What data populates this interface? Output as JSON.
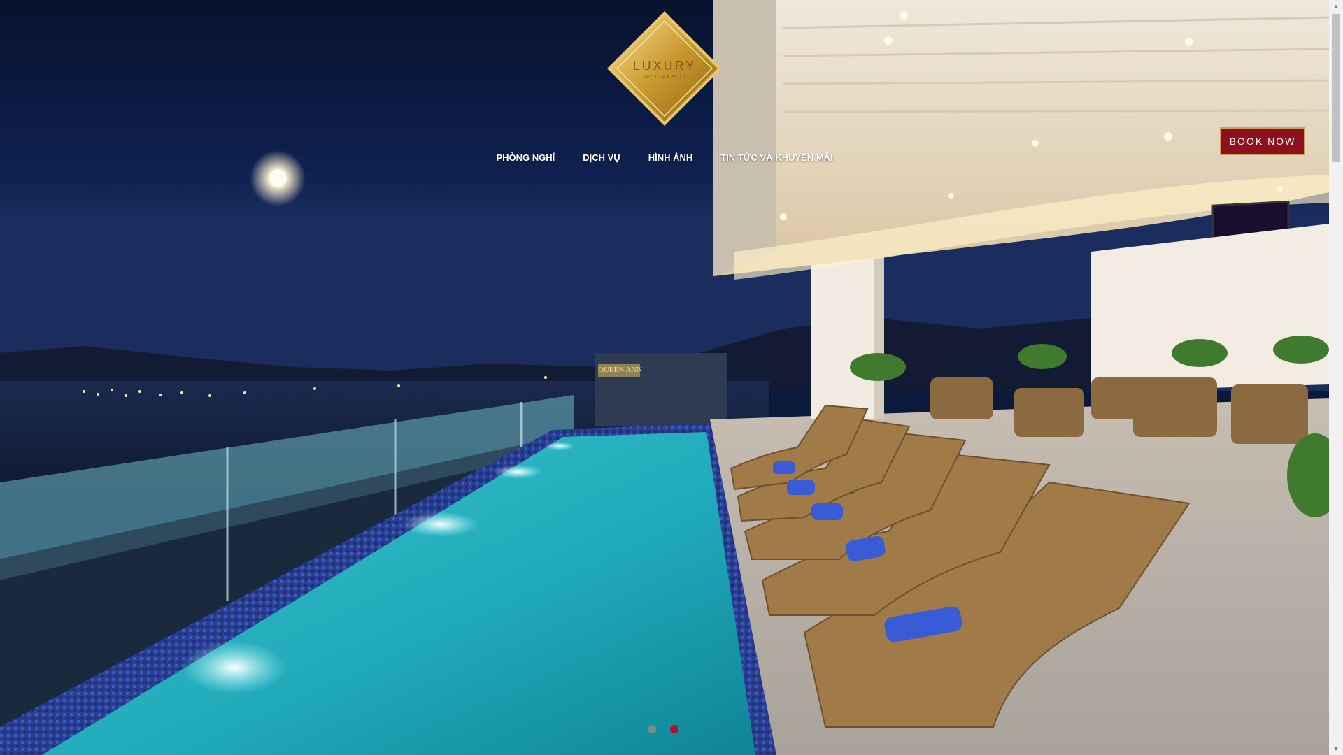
{
  "logo": {
    "brand": "LUXURY",
    "tagline": "VECTOR EPS 10"
  },
  "nav": {
    "items": [
      {
        "label": "PHÒNG NGHỈ"
      },
      {
        "label": "DỊCH VỤ"
      },
      {
        "label": "HÌNH ẢNH"
      },
      {
        "label": "TIN TỨC VÀ KHUYẾN MÃI"
      }
    ]
  },
  "book_button": {
    "label": "BOOK NOW"
  },
  "hero": {
    "sign_text": "QUEEN ANN",
    "slides_total": 2,
    "active_slide": 2
  },
  "colors": {
    "accent": "#8e0f1d",
    "gold": "#c8a55a",
    "pool": "#2bb3c0",
    "sky": "#0b1a3a"
  }
}
